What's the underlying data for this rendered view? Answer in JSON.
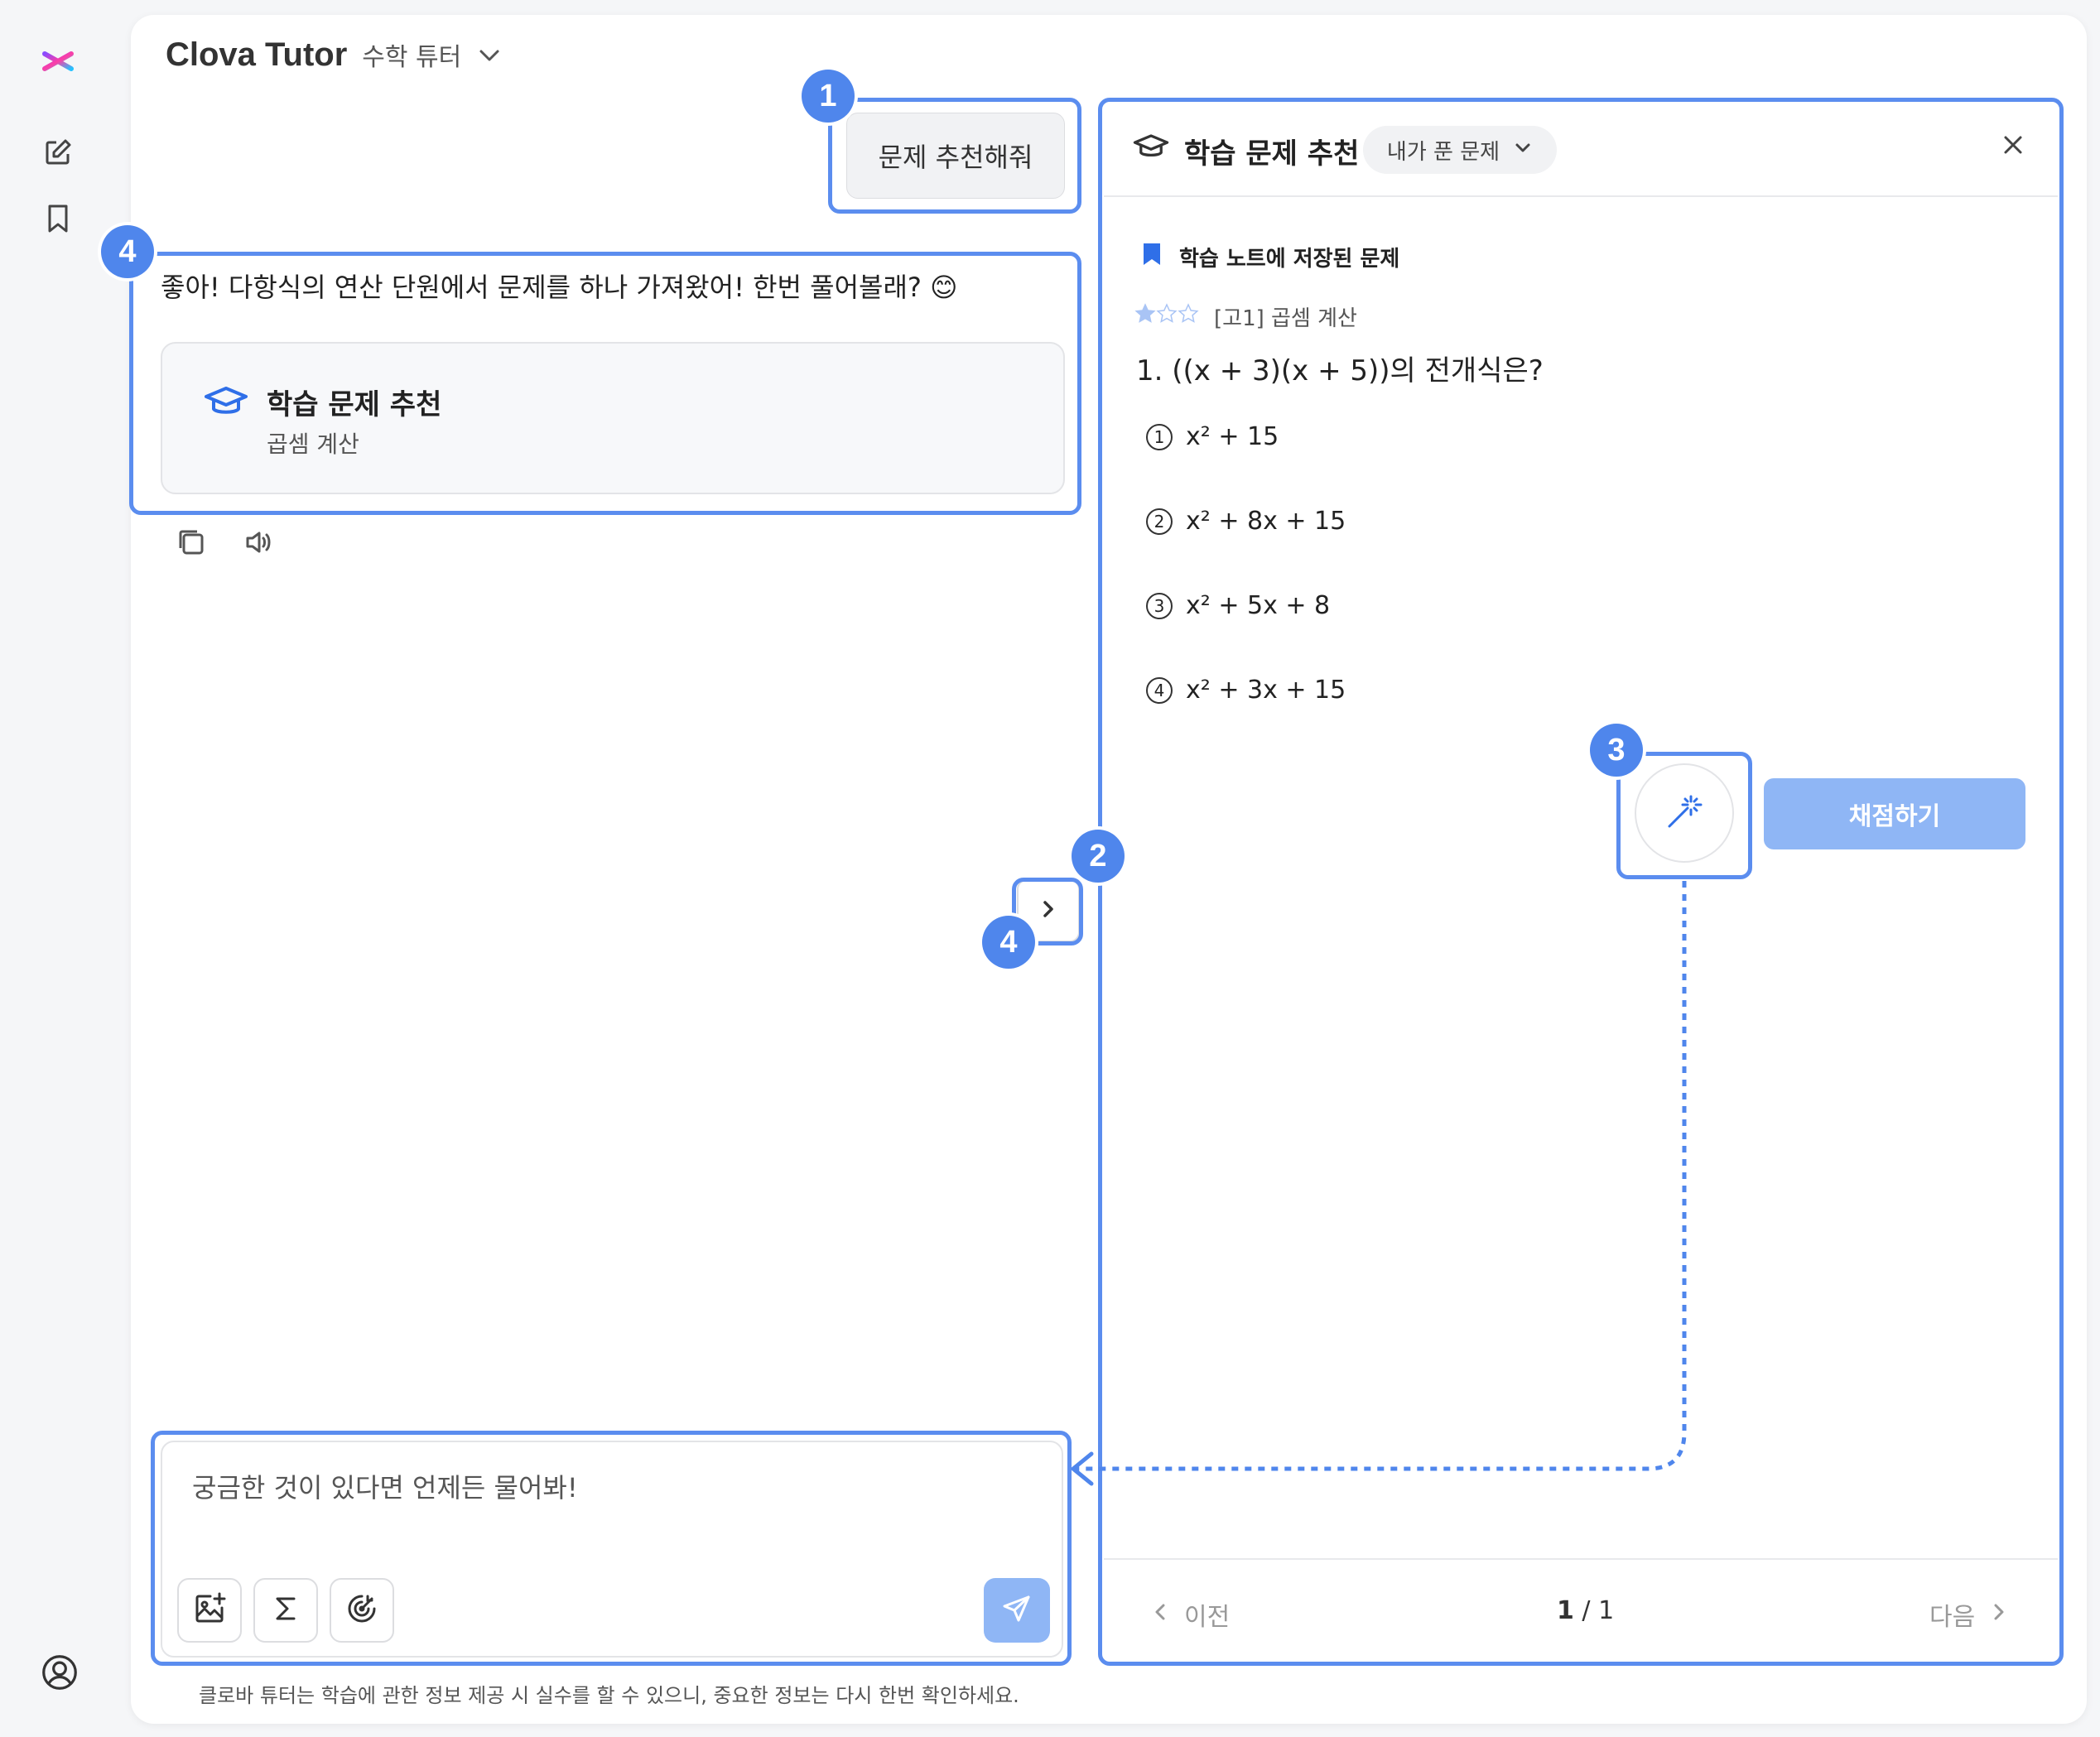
{
  "app": {
    "name": "Clova Tutor",
    "mode": "수학 튜터"
  },
  "chat": {
    "user_message": "문제 추천해줘",
    "ai_message": "좋아! 다항식의 연산 단원에서 문제를 하나 가져왔어! 한번 풀어볼래? 😊",
    "rec_card": {
      "title": "학습 문제 추천",
      "subtitle": "곱셈 계산"
    }
  },
  "input": {
    "placeholder": "궁금한 것이 있다면 언제든 물어봐!",
    "disclaimer": "클로바 튜터는 학습에 관한 정보 제공 시 실수를 할 수 있으니, 중요한 정보는 다시 한번 확인하세요."
  },
  "panel": {
    "title": "학습 문제 추천",
    "filter": "내가 푼 문제",
    "saved_label": "학습 노트에 저장된 문제",
    "meta": "[고1] 곱셈 계산",
    "rating": 1,
    "question": "1. ((x + 3)(x + 5))의 전개식은?",
    "options": [
      {
        "num": "1",
        "text": "x² + 15"
      },
      {
        "num": "2",
        "text": "x² + 8x + 15"
      },
      {
        "num": "3",
        "text": "x² + 5x + 8"
      },
      {
        "num": "4",
        "text": "x² + 3x + 15"
      }
    ],
    "grade_button": "채점하기",
    "prev": "이전",
    "next": "다음",
    "page_current": "1",
    "page_total": "/ 1"
  },
  "annotations": [
    "1",
    "2",
    "3",
    "4",
    "4",
    "4"
  ],
  "colors": {
    "accent": "#4f86ec",
    "button_disabled": "#8fb6f5",
    "bookmark": "#2f6fe8"
  },
  "icons": [
    "asterisk-logo-icon",
    "edit-icon",
    "bookmark-icon",
    "profile-icon",
    "chevron-down-icon",
    "graduation-cap-icon",
    "copy-icon",
    "speaker-icon",
    "chevron-right-icon",
    "image-add-icon",
    "sigma-icon",
    "target-icon",
    "send-icon",
    "close-icon",
    "bookmark-filled-icon",
    "star-icon",
    "magic-wand-icon",
    "chevron-left-icon"
  ]
}
